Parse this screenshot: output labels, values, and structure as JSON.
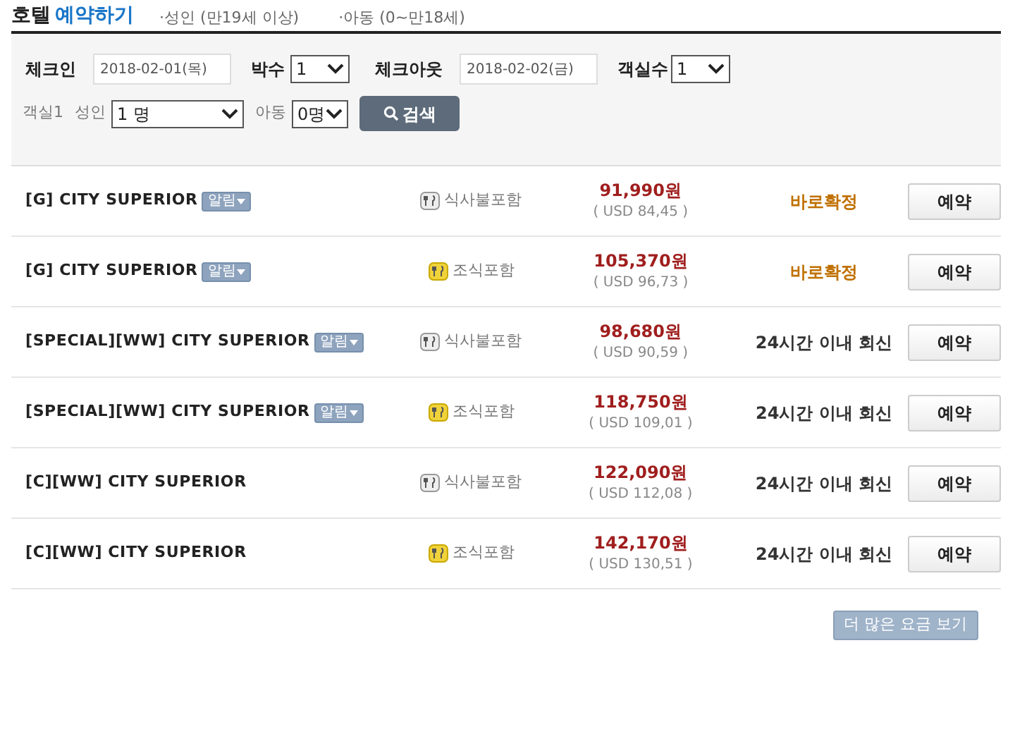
{
  "header": {
    "title_plain": "호텔",
    "title_accent": "예약하기",
    "notes": [
      "·성인 (만19세 이상)",
      "·아동 (0~만18세)"
    ]
  },
  "search": {
    "checkin_label": "체크인",
    "checkin": "2018-02-01(목)",
    "nights_label": "박수",
    "nights": "1",
    "checkout_label": "체크아웃",
    "checkout": "2018-02-02(금)",
    "rooms_label": "객실수",
    "rooms": "1",
    "room_label": "객실1",
    "adult_label": "성인",
    "adults": "1 명",
    "child_label": "아동",
    "children": "0명",
    "search_button": "검색"
  },
  "rooms": [
    {
      "name": "[G] CITY SUPERIOR",
      "badge": "알림",
      "meal": {
        "kind": "none",
        "text": "식사불포함"
      },
      "price": "91,990원",
      "usd": "( USD 84,45 )",
      "confirm": {
        "kind": "instant",
        "text": "바로확정"
      },
      "button": "예약"
    },
    {
      "name": "[G] CITY SUPERIOR",
      "badge": "알림",
      "meal": {
        "kind": "breakfast",
        "text": "조식포함"
      },
      "price": "105,370원",
      "usd": "( USD 96,73 )",
      "confirm": {
        "kind": "instant",
        "text": "바로확정"
      },
      "button": "예약"
    },
    {
      "name": "[SPECIAL][WW] CITY SUPERIOR",
      "badge": "알림",
      "meal": {
        "kind": "none",
        "text": "식사불포함"
      },
      "price": "98,680원",
      "usd": "( USD 90,59 )",
      "confirm": {
        "kind": "reply",
        "text": "24시간 이내 회신"
      },
      "button": "예약"
    },
    {
      "name": "[SPECIAL][WW] CITY SUPERIOR",
      "badge": "알림",
      "meal": {
        "kind": "breakfast",
        "text": "조식포함"
      },
      "price": "118,750원",
      "usd": "( USD 109,01 )",
      "confirm": {
        "kind": "reply",
        "text": "24시간 이내 회신"
      },
      "button": "예약"
    },
    {
      "name": "[C][WW] CITY SUPERIOR",
      "meal": {
        "kind": "none",
        "text": "식사불포함"
      },
      "price": "122,090원",
      "usd": "( USD 112,08 )",
      "confirm": {
        "kind": "reply",
        "text": "24시간 이내 회신"
      },
      "button": "예약"
    },
    {
      "name": "[C][WW] CITY SUPERIOR",
      "meal": {
        "kind": "breakfast",
        "text": "조식포함"
      },
      "price": "142,170원",
      "usd": "( USD 130,51 )",
      "confirm": {
        "kind": "reply",
        "text": "24시간 이내 회신"
      },
      "button": "예약"
    }
  ],
  "more_button": "더 많은 요금 보기"
}
